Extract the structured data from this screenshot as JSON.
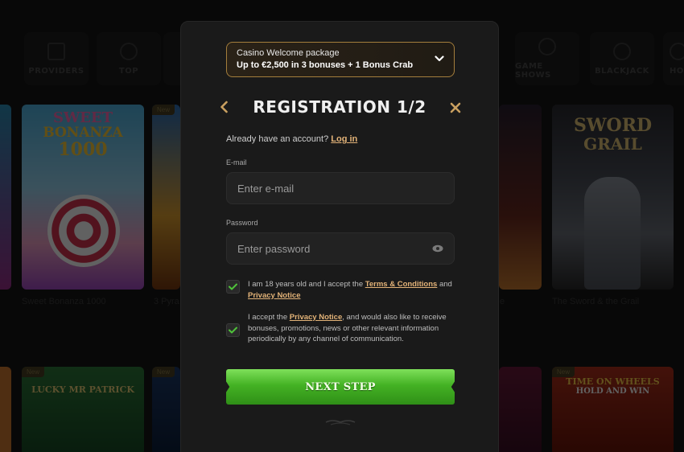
{
  "background": {
    "nav_left": [
      {
        "label": "PROVIDERS",
        "icon": "grid-icon"
      },
      {
        "label": "TOP",
        "icon": "medal-icon"
      }
    ],
    "nav_right": [
      {
        "label": "GAME SHOWS",
        "icon": "wheel-icon"
      },
      {
        "label": "BLACKJACK",
        "icon": "spade-icon"
      },
      {
        "label": "HOT",
        "icon": "flame-icon"
      }
    ],
    "new_badge": "New",
    "tiles": {
      "sweet_bonanza": {
        "caption": "Sweet Bonanza 1000",
        "art_line1": "SWEET",
        "art_line2": "BONANZA",
        "art_line3": "1000"
      },
      "pyramid": {
        "caption": "3 Pyra"
      },
      "mid_right": {
        "caption": "e"
      },
      "sword_grail": {
        "caption": "The Sword & the Grail",
        "art_line1": "SWORD",
        "art_line2": "GRAIL"
      },
      "lucky_patrick": {
        "art": "LUCKY MR PATRICK"
      },
      "hold_win": {
        "art_line1": "TIME ON WHEELS",
        "art_line2": "HOLD AND WIN"
      }
    }
  },
  "modal": {
    "promo": {
      "line1": "Casino Welcome package",
      "line2": "Up to €2,500 in 3 bonuses + 1 Bonus Crab"
    },
    "title": "REGISTRATION 1/2",
    "have_account": "Already have an account?",
    "login_link": "Log in",
    "email_label": "E-mail",
    "email_placeholder": "Enter e-mail",
    "password_label": "Password",
    "password_placeholder": "Enter password",
    "terms": {
      "text_before": "I am 18 years old and I accept the ",
      "link1": "Terms & Conditions",
      "text_mid": " and ",
      "link2": "Privacy Notice"
    },
    "marketing": {
      "text_before": "I accept the ",
      "link": "Privacy Notice",
      "text_after": ", and would also like to receive bonuses, promotions, news or other relevant information periodically by any channel of communication."
    },
    "next_button": "NEXT STEP",
    "colors": {
      "accent": "#e3b378",
      "button_green": "#44b224",
      "check_green": "#4fc23a"
    }
  }
}
